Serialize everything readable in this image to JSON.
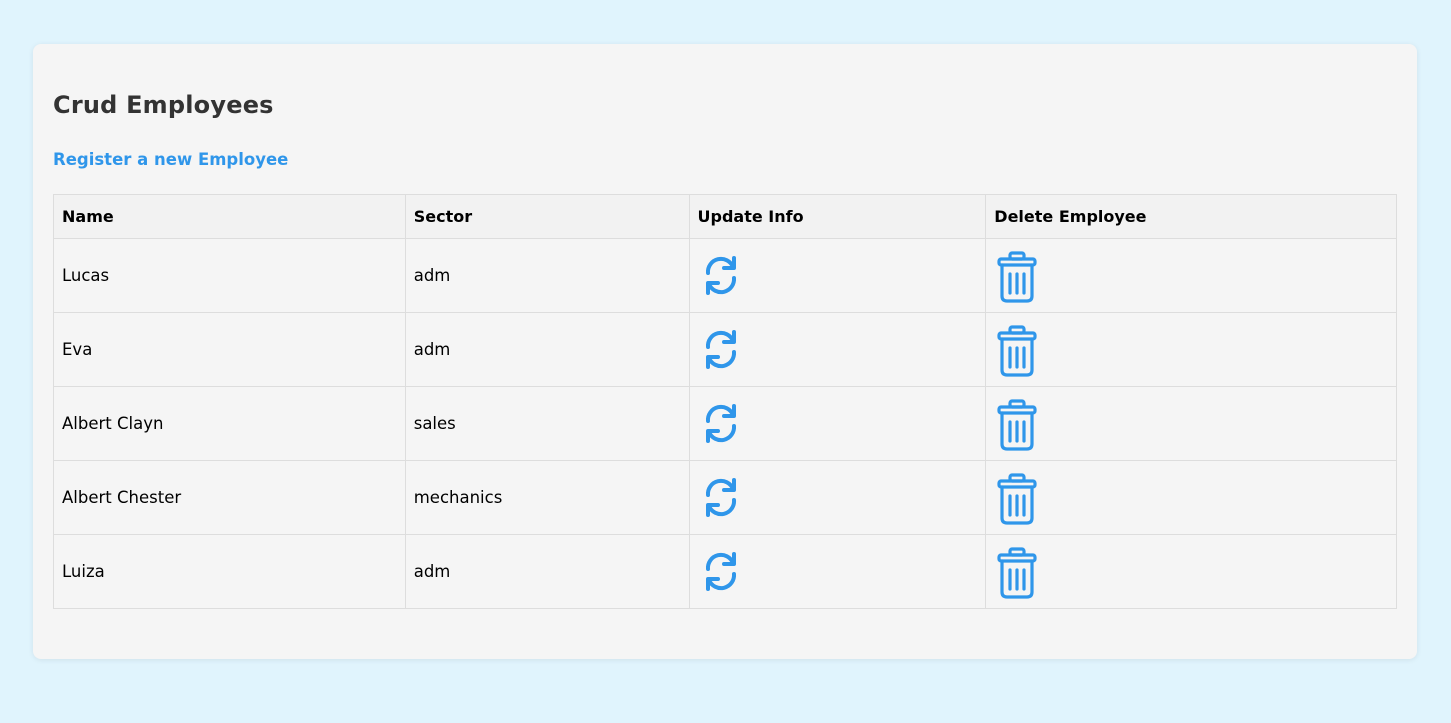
{
  "page": {
    "title": "Crud Employees",
    "register_link": "Register a new Employee"
  },
  "table": {
    "headers": {
      "name": "Name",
      "sector": "Sector",
      "update": "Update Info",
      "delete": "Delete Employee"
    },
    "rows": [
      {
        "name": "Lucas",
        "sector": "adm"
      },
      {
        "name": "Eva",
        "sector": "adm"
      },
      {
        "name": "Albert Clayn",
        "sector": "sales"
      },
      {
        "name": "Albert Chester",
        "sector": "mechanics"
      },
      {
        "name": "Luiza",
        "sector": "adm"
      }
    ],
    "update_icon": "refresh-icon",
    "delete_icon": "trash-icon"
  },
  "colors": {
    "background": "#e0f4fd",
    "card": "#f5f5f5",
    "accent": "#2f96ea",
    "title": "#333333"
  }
}
